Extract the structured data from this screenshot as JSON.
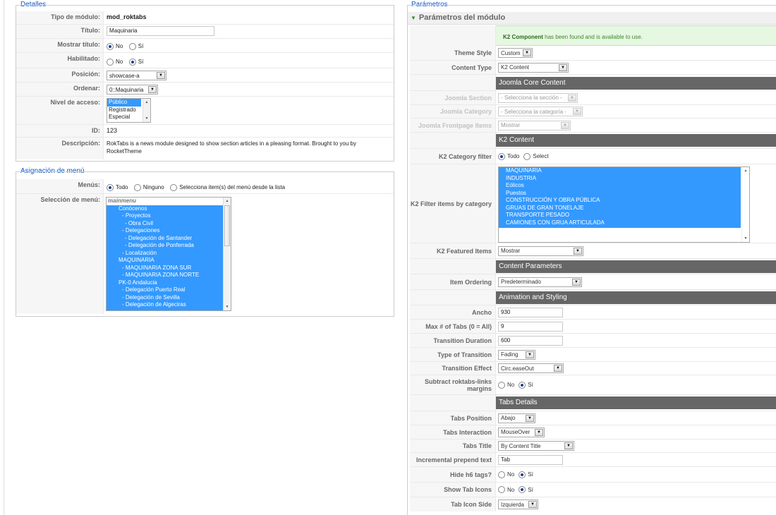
{
  "detalles": {
    "legend": "Detalles",
    "tipo_label": "Tipo de módulo:",
    "tipo_value": "mod_roktabs",
    "titulo_label": "Título:",
    "titulo_value": "Maquinaria",
    "mostrar_label": "Mostrar título:",
    "habilitado_label": "Habilitado:",
    "no": "No",
    "si": "Sí",
    "posicion_label": "Posición:",
    "posicion_value": "showcase-a",
    "ordenar_label": "Ordenar:",
    "ordenar_value": "0::Maquinaria",
    "nivel_label": "Nivel de acceso:",
    "nivel_options": [
      "Público",
      "Registrado",
      "Especial"
    ],
    "id_label": "ID:",
    "id_value": "123",
    "desc_label": "Descripción:",
    "desc_value": "RokTabs is a news module designed to show section articles in a pleasing format. Brought to you by RocketTheme"
  },
  "asignacion": {
    "legend": "Asignación de menú",
    "menus_label": "Menús:",
    "opt_todo": "Todo",
    "opt_ninguno": "Ninguno",
    "opt_select": "Selecciona item(s) del menú desde la lista",
    "seleccion_label": "Selección de menú:",
    "menu_items": [
      "mainmenu",
      "Conócenos",
      "- Proyectos",
      "- Obra Civil",
      "- Delegaciones",
      "- Delegación de Santander",
      "- Delegación de Ponferrada",
      "- Localización",
      "MAQUINARIA",
      "- MAQUINARIA ZONA SUR",
      "- MAQUINARIA ZONA NORTE",
      "PK-0 Andalucia",
      "- Delegación Puerto Real",
      "- Delegación de Sevilla",
      "- Delegación de Algeciras"
    ]
  },
  "parametros": {
    "legend": "Parámetros",
    "pane_title": "Parámetros del módulo",
    "notice_bold": "K2 Component",
    "notice_rest": " has been found and is available to use.",
    "theme_style_label": "Theme Style",
    "theme_style_value": "Custom",
    "content_type_label": "Content Type",
    "content_type_value": "K2 Content",
    "joomla_core_header": "Joomla Core Content",
    "joomla_section_label": "Joomla Section",
    "joomla_section_value": "- Selecciona la sección -",
    "joomla_category_label": "Joomla Category",
    "joomla_category_value": "- Selecciona la categoría -",
    "joomla_frontpage_label": "Joomla Frontpage Items",
    "joomla_frontpage_value": "Mostrar",
    "k2_header": "K2 Content",
    "k2_category_filter_label": "K2 Category filter",
    "opt_todo": "Todo",
    "opt_select": "Select",
    "k2_filter_items_label": "K2 Filter items by category",
    "k2_categories": [
      "MAQUINARIA",
      "INDUSTRIA",
      "Eólicos",
      "Puestos",
      "CONSTRUCCIÓN Y OBRA PÚBLICA",
      "GRUAS DE GRAN TONELAJE",
      "TRANSPORTE PESADO",
      "CAMIONES CON GRUA ARTICULADA"
    ],
    "k2_featured_label": "K2 Featured Items",
    "k2_featured_value": "Mostrar",
    "content_params_header": "Content Parameters",
    "item_ordering_label": "Item Ordering",
    "item_ordering_value": "Predeterminado",
    "animation_header": "Animation and Styling",
    "ancho_label": "Ancho",
    "ancho_value": "930",
    "max_tabs_label": "Max # of Tabs (0 = All)",
    "max_tabs_value": "9",
    "transition_duration_label": "Transition Duration",
    "transition_duration_value": "600",
    "type_transition_label": "Type of Transition",
    "type_transition_value": "Fading",
    "transition_effect_label": "Transition Effect",
    "transition_effect_value": "Circ.easeOut",
    "subtract_label": "Subtract roktabs-links margins",
    "no": "No",
    "si": "Sí",
    "tabs_details_header": "Tabs Details",
    "tabs_position_label": "Tabs Position",
    "tabs_position_value": "Abajo",
    "tabs_interaction_label": "Tabs Interaction",
    "tabs_interaction_value": "MouseOver",
    "tabs_title_label": "Tabs Title",
    "tabs_title_value": "By Content Title",
    "incremental_label": "Incremental prepend text",
    "incremental_value": "Tab",
    "hide_h6_label": "Hide h6 tags?",
    "show_icons_label": "Show Tab Icons",
    "icon_side_label": "Tab Icon Side",
    "icon_side_value": "Izquierda"
  }
}
